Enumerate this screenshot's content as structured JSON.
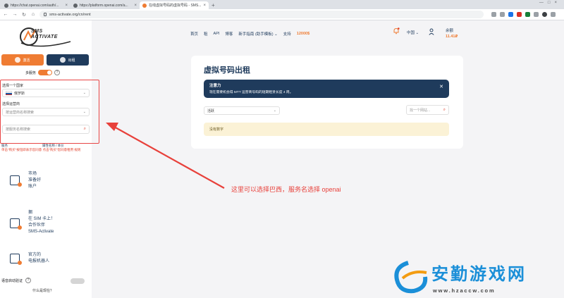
{
  "browser": {
    "tabs": [
      {
        "label": "https://chat.openai.com/auth/..."
      },
      {
        "label": "https://platform.openai.com/a..."
      },
      {
        "label": "在线虚拟号码的虚拟号码 - SMS..."
      }
    ],
    "new_tab": "+",
    "url": "sms-activate.org/cn/rent"
  },
  "sidebar": {
    "logo_text_line1": "SMS",
    "logo_text_line2": "ACTIVATE",
    "receive_button": "激活",
    "rent_button": "出租",
    "multi_service_label": "多服务",
    "help_mark": "?",
    "country_label": "选择一个国家",
    "country_value": "俄罗斯",
    "service_label": "选择运营商",
    "service_placeholder": "按运营商名称搜索",
    "search_service_placeholder": "按服务名称搜索",
    "service_col_left": "服务",
    "service_col_right": "属性名称 / 本价",
    "hint_text": "单击\"购买\"按钮即表示您同意 点击\"购买\"您同意租用 规则",
    "features": [
      {
        "lines": [
          "市场",
          "准备好",
          "账户"
        ]
      },
      {
        "lines": [
          "捆",
          "在 SIM 卡上！",
          "合作伙伴",
          "SMS-Activate"
        ]
      },
      {
        "lines": [
          "官方的",
          "电报机器人"
        ]
      }
    ],
    "voice_label": "语音启动验证",
    "what_is_this": "什么是现在？"
  },
  "topnav": {
    "items": [
      "首页",
      "租",
      "API",
      "博客",
      "新手指南 (助手模板)"
    ],
    "support": "支持",
    "balance_link": "12000$",
    "language": "中国",
    "balance_label": "余额",
    "balance_amount": "11.41₽"
  },
  "main": {
    "title": "虚拟号码出租",
    "notice_title": "注意力",
    "notice_body": "现在需要机会得 MTT 运营商号码的短期租赁长度 4 周。",
    "lease_select": "活跃",
    "site_search_placeholder": "找一个网站...",
    "no_data": "没有数字"
  },
  "annotation": {
    "text": "这里可以选择巴西，服务名选择 openai"
  },
  "watermark": {
    "cn": "安勤游戏网",
    "url": "www.hzaccw.com"
  },
  "colors": {
    "accent_orange": "#ef7c33",
    "navy": "#1f3b5c",
    "annotation_red": "#e8413b",
    "watermark_blue": "#1b8fd8"
  }
}
